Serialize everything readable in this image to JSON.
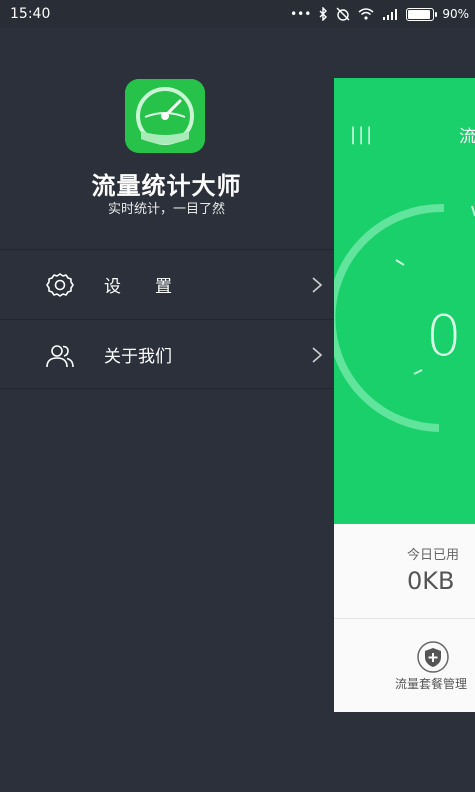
{
  "status_bar": {
    "time": "15:40",
    "dots": "•••",
    "battery_percent": "90%",
    "battery_level": 0.9
  },
  "drawer": {
    "app_title": "流量统计大师",
    "app_subtitle": "实时统计，一目了然",
    "menu": [
      {
        "label": "设　　置",
        "icon": "gear-icon"
      },
      {
        "label": "关于我们",
        "icon": "users-icon"
      }
    ]
  },
  "main": {
    "menu_glyph": "|||",
    "header_title": "流",
    "gauge_value": "0",
    "today_label": "今日已用",
    "today_value": "0KB",
    "plan_label": "流量套餐管理"
  },
  "colors": {
    "drawer_bg": "#2b303b",
    "accent_green": "#19d06a",
    "logo_green": "#27c24a"
  }
}
